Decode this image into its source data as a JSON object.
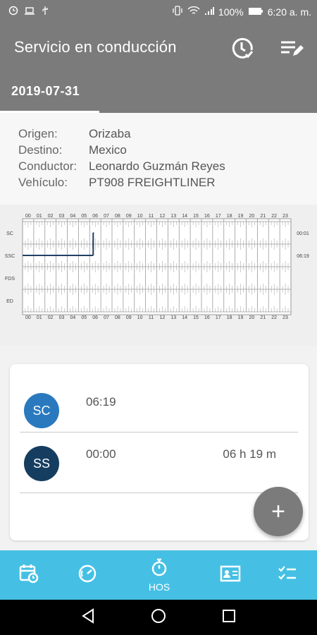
{
  "status_bar": {
    "battery": "100%",
    "time": "6:20 a. m."
  },
  "app_bar": {
    "title": "Servicio en conducción",
    "tab_label": "2019-07-31"
  },
  "trip_info": [
    {
      "label": "Origen:",
      "value": "Orizaba"
    },
    {
      "label": "Destino:",
      "value": "Mexico"
    },
    {
      "label": "Conductor:",
      "value": "Leonardo Guzmán Reyes"
    },
    {
      "label": "Vehículo:",
      "value": "PT908 FREIGHTLINER"
    }
  ],
  "chart_data": {
    "type": "line",
    "hours": [
      "00",
      "01",
      "02",
      "03",
      "04",
      "05",
      "06",
      "07",
      "08",
      "09",
      "10",
      "11",
      "12",
      "13",
      "14",
      "15",
      "16",
      "17",
      "18",
      "19",
      "20",
      "21",
      "22",
      "23"
    ],
    "rows": [
      "SC",
      "SSC",
      "FDS",
      "ED"
    ],
    "row_totals": [
      "00:01",
      "06:19",
      "",
      ""
    ],
    "segments": [
      {
        "row": "SSC",
        "start": "00:00",
        "end": "06:19"
      },
      {
        "row": "SC",
        "start": "06:19",
        "end": "06:20"
      }
    ],
    "line_color": "#1f3f66"
  },
  "records": [
    {
      "badge": "SC",
      "badge_color": "#2a79bf",
      "time": "06:19",
      "duration": ""
    },
    {
      "badge": "SS",
      "badge_color": "#153d60",
      "time": "00:00",
      "duration": "06 h 19 m"
    }
  ],
  "fab": {
    "icon": "plus-icon",
    "label": "+"
  },
  "bottom_nav": [
    {
      "icon": "calendar-clock-icon",
      "label": ""
    },
    {
      "icon": "speedometer-icon",
      "label": ""
    },
    {
      "icon": "stopwatch-icon",
      "label": "HOS"
    },
    {
      "icon": "id-card-icon",
      "label": ""
    },
    {
      "icon": "checklist-icon",
      "label": ""
    }
  ],
  "colors": {
    "app_bar": "#7b7b7b",
    "bottom_nav": "#45c0e4"
  }
}
